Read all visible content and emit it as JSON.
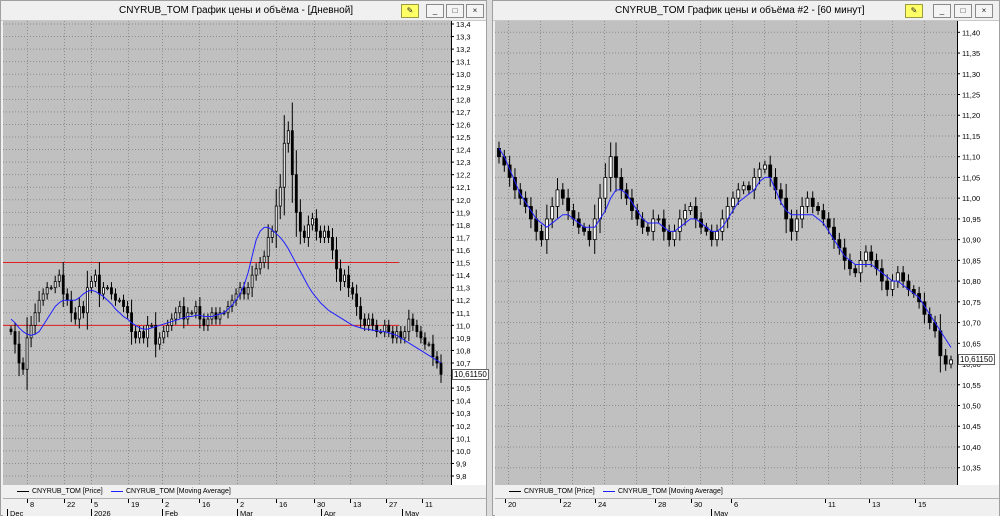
{
  "colors": {
    "plot_bg": "#c0c0c0",
    "grid": "#8c8c8c",
    "ma_line": "#2020ff",
    "level_line": "#e02020",
    "candle": "#000000"
  },
  "left": {
    "title": "CNYRUB_TOM График цены и объёма - [Дневной]",
    "buttons": {
      "pin": "pin-icon",
      "minimize": "_",
      "maximize": "□",
      "close": "×"
    },
    "price_label": "10,61150",
    "legend": {
      "price": "CNYRUB_TOM [Price]",
      "ma": "CNYRUB_TOM [Moving Average]"
    },
    "x_top": [
      "8",
      "22",
      "5",
      "19",
      "2",
      "16",
      "2",
      "16",
      "30",
      "13",
      "27",
      "11"
    ],
    "x_bottom": [
      "Dec",
      "2026",
      "Feb",
      "Mar",
      "Apr",
      "May"
    ]
  },
  "right": {
    "title": "CNYRUB_TOM График цены и объёма #2 - [60 минут]",
    "buttons": {
      "pin": "pin-icon",
      "minimize": "_",
      "maximize": "□",
      "close": "×"
    },
    "price_label": "10,61150",
    "legend": {
      "price": "CNYRUB_TOM [Price]",
      "ma": "CNYRUB_TOM [Moving Average]"
    },
    "x_top": [
      "20",
      "22",
      "24",
      "28",
      "30",
      "6",
      "11",
      "13",
      "15"
    ],
    "x_bottom": [
      "May"
    ]
  },
  "chart_data": [
    {
      "type": "candlestick",
      "title": "CNYRUB_TOM График цены и объёма - [Дневной]",
      "y_ticks": [
        "13,4",
        "13,3",
        "13,2",
        "13,1",
        "13,0",
        "12,9",
        "12,8",
        "12,7",
        "12,6",
        "12,5",
        "12,4",
        "12,3",
        "12,2",
        "12,1",
        "12,0",
        "11,9",
        "11,8",
        "11,7",
        "11,6",
        "11,5",
        "11,4",
        "11,3",
        "11,2",
        "11,1",
        "11,0",
        "10,9",
        "10,8",
        "10,7",
        "10,6",
        "10,5",
        "10,4",
        "10,3",
        "10,2",
        "10,1",
        "10,0",
        "9,9",
        "9,8"
      ],
      "ylim": [
        9.8,
        13.4
      ],
      "horizontal_levels": [
        11.5,
        11.0
      ],
      "last_price": 10.6115,
      "close": [
        10.95,
        10.85,
        10.7,
        10.65,
        10.9,
        11.0,
        11.1,
        11.2,
        11.25,
        11.3,
        11.3,
        11.35,
        11.4,
        11.25,
        11.2,
        11.1,
        11.05,
        11.15,
        11.1,
        11.3,
        11.35,
        11.4,
        11.25,
        11.3,
        11.3,
        11.25,
        11.2,
        11.2,
        11.15,
        11.1,
        10.95,
        10.9,
        10.95,
        10.9,
        11.0,
        11.0,
        10.85,
        10.9,
        10.95,
        11.0,
        11.05,
        11.1,
        11.15,
        11.05,
        11.1,
        11.1,
        11.15,
        11.05,
        11.0,
        11.05,
        11.1,
        11.05,
        11.1,
        11.1,
        11.15,
        11.2,
        11.25,
        11.3,
        11.25,
        11.3,
        11.4,
        11.45,
        11.5,
        11.55,
        11.7,
        11.75,
        11.95,
        12.1,
        12.45,
        12.55,
        12.2,
        11.9,
        11.75,
        11.7,
        11.8,
        11.85,
        11.75,
        11.7,
        11.75,
        11.7,
        11.6,
        11.45,
        11.35,
        11.4,
        11.3,
        11.25,
        11.15,
        11.05,
        11.0,
        11.05,
        11.0,
        10.95,
        10.95,
        11.0,
        10.95,
        10.9,
        10.95,
        10.9,
        10.95,
        11.05,
        11.0,
        10.95,
        10.9,
        10.85,
        10.85,
        10.75,
        10.7,
        10.61
      ],
      "moving_average": [
        11.05,
        11.02,
        10.98,
        10.95,
        10.93,
        10.92,
        10.93,
        10.95,
        11.0,
        11.05,
        11.1,
        11.15,
        11.18,
        11.2,
        11.2,
        11.2,
        11.2,
        11.22,
        11.25,
        11.27,
        11.28,
        11.27,
        11.25,
        11.23,
        11.2,
        11.17,
        11.13,
        11.1,
        11.07,
        11.05,
        11.02,
        11.0,
        10.98,
        10.97,
        10.97,
        10.98,
        10.99,
        11.0,
        11.01,
        11.02,
        11.03,
        11.04,
        11.05,
        11.06,
        11.07,
        11.07,
        11.08,
        11.08,
        11.07,
        11.07,
        11.07,
        11.08,
        11.09,
        11.1,
        11.13,
        11.16,
        11.2,
        11.25,
        11.32,
        11.42,
        11.55,
        11.68,
        11.75,
        11.78,
        11.78,
        11.76,
        11.73,
        11.7,
        11.66,
        11.61,
        11.55,
        11.49,
        11.43,
        11.37,
        11.31,
        11.26,
        11.22,
        11.18,
        11.15,
        11.12,
        11.1,
        11.08,
        11.06,
        11.04,
        11.02,
        11.0,
        10.99,
        10.98,
        10.97,
        10.97,
        10.96,
        10.96,
        10.95,
        10.95,
        10.94,
        10.93,
        10.92,
        10.9,
        10.88,
        10.86,
        10.84,
        10.82,
        10.8,
        10.78,
        10.76,
        10.74,
        10.72,
        10.7
      ]
    },
    {
      "type": "candlestick",
      "title": "CNYRUB_TOM График цены и объёма #2 - [60 минут]",
      "y_ticks": [
        "11,40",
        "11,35",
        "11,30",
        "11,25",
        "11,20",
        "11,15",
        "11,10",
        "11,05",
        "11,00",
        "10,95",
        "10,90",
        "10,85",
        "10,80",
        "10,75",
        "10,70",
        "10,65",
        "10,60",
        "10,55",
        "10,50",
        "10,45",
        "10,40",
        "10,35"
      ],
      "ylim": [
        10.33,
        11.42
      ],
      "last_price": 10.6115,
      "close": [
        11.1,
        11.08,
        11.05,
        11.02,
        11.0,
        10.98,
        10.95,
        10.92,
        10.9,
        10.95,
        10.98,
        11.02,
        11.0,
        10.97,
        10.95,
        10.93,
        10.92,
        10.9,
        10.95,
        11.0,
        11.05,
        11.1,
        11.05,
        11.02,
        11.0,
        10.97,
        10.95,
        10.93,
        10.92,
        10.95,
        10.95,
        10.92,
        10.9,
        10.92,
        10.95,
        10.97,
        10.98,
        10.95,
        10.93,
        10.92,
        10.9,
        10.92,
        10.95,
        10.98,
        11.0,
        11.02,
        11.03,
        11.02,
        11.05,
        11.07,
        11.08,
        11.05,
        11.02,
        11.0,
        10.95,
        10.92,
        10.95,
        10.98,
        11.0,
        10.98,
        10.97,
        10.95,
        10.93,
        10.9,
        10.88,
        10.85,
        10.83,
        10.82,
        10.85,
        10.87,
        10.85,
        10.83,
        10.8,
        10.78,
        10.8,
        10.82,
        10.8,
        10.78,
        10.77,
        10.75,
        10.72,
        10.7,
        10.68,
        10.62,
        10.6,
        10.61
      ],
      "moving_average": [
        11.12,
        11.1,
        11.07,
        11.04,
        11.01,
        10.99,
        10.97,
        10.95,
        10.94,
        10.93,
        10.94,
        10.95,
        10.96,
        10.96,
        10.95,
        10.94,
        10.93,
        10.93,
        10.93,
        10.95,
        10.97,
        11.0,
        11.02,
        11.02,
        11.01,
        10.99,
        10.97,
        10.95,
        10.94,
        10.94,
        10.94,
        10.93,
        10.92,
        10.92,
        10.93,
        10.94,
        10.95,
        10.95,
        10.94,
        10.93,
        10.92,
        10.92,
        10.93,
        10.95,
        10.97,
        10.99,
        11.0,
        11.01,
        11.02,
        11.04,
        11.05,
        11.05,
        11.02,
        10.99,
        10.97,
        10.96,
        10.96,
        10.96,
        10.96,
        10.96,
        10.95,
        10.94,
        10.92,
        10.9,
        10.88,
        10.86,
        10.85,
        10.84,
        10.84,
        10.84,
        10.84,
        10.83,
        10.82,
        10.81,
        10.8,
        10.8,
        10.79,
        10.78,
        10.77,
        10.76,
        10.74,
        10.72,
        10.7,
        10.68,
        10.66,
        10.64
      ]
    }
  ]
}
